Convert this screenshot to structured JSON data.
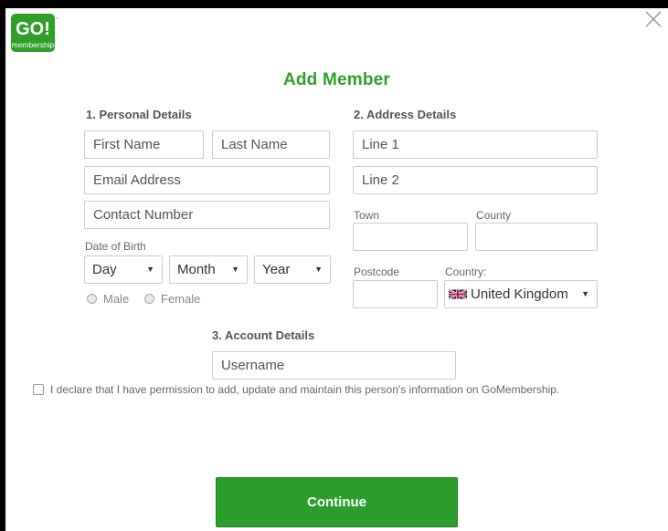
{
  "modal": {
    "title": "Add Member",
    "logo": {
      "top": "GO!",
      "bottom": "membership",
      "tm": "™"
    },
    "close_icon": "close-icon"
  },
  "personal": {
    "heading": "1. Personal Details",
    "first_name_placeholder": "First Name",
    "last_name_placeholder": "Last Name",
    "email_placeholder": "Email Address",
    "contact_placeholder": "Contact Number",
    "dob_label": "Date of Birth",
    "day": "Day",
    "month": "Month",
    "year": "Year",
    "male": "Male",
    "female": "Female"
  },
  "address": {
    "heading": "2. Address Details",
    "line1_placeholder": "Line 1",
    "line2_placeholder": "Line 2",
    "town_label": "Town",
    "county_label": "County",
    "postcode_label": "Postcode",
    "country_label": "Country:",
    "country_value": "United Kingdom"
  },
  "account": {
    "heading": "3. Account Details",
    "username_placeholder": "Username"
  },
  "declaration": "I declare that I have permission to add, update and maintain this person's information on GoMembership.",
  "continue_label": "Continue",
  "colors": {
    "brand_green": "#2f9e2a",
    "button_green": "#2a9d2a",
    "border": "#cccccc"
  }
}
